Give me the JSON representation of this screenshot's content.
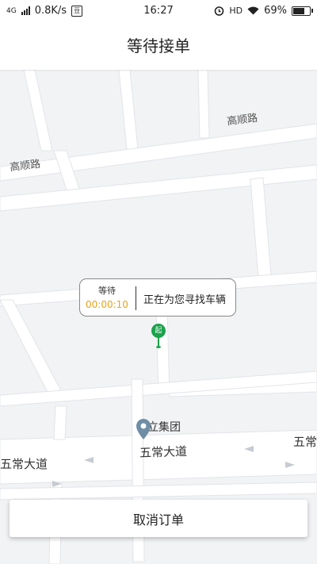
{
  "status_bar": {
    "network": "4G",
    "speed": "0.8K/s",
    "notification_badge": "豆",
    "time": "16:27",
    "hd": "HD",
    "battery": "69%"
  },
  "header": {
    "title": "等待接单"
  },
  "map": {
    "road_labels": [
      "高顺路",
      "高顺路",
      "五常大道",
      "五常大道",
      "五常"
    ],
    "poi_name": "华立集团",
    "pin_label": "起"
  },
  "waiting_card": {
    "label": "等待",
    "timer": "00:00:10",
    "status": "正在为您寻找车辆",
    "timer_color": "#e8a317"
  },
  "actions": {
    "cancel_label": "取消订单"
  },
  "colors": {
    "pin": "#1aa34a",
    "poi_marker": "#6f8ea6"
  }
}
